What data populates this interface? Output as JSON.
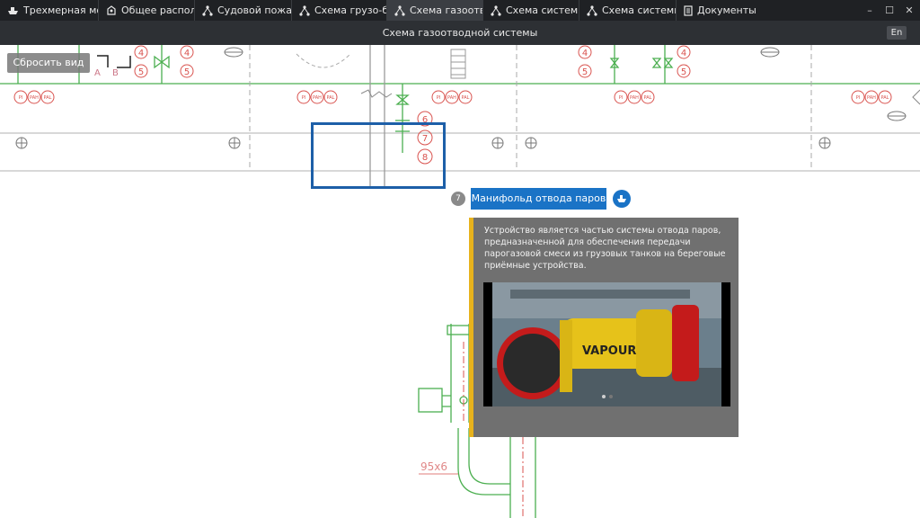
{
  "tabs": [
    {
      "label": "Трехмерная модель",
      "icon": "ship-icon",
      "active": false
    },
    {
      "label": "Общее расположение",
      "icon": "layout-icon",
      "active": false
    },
    {
      "label": "Судовой пожарный",
      "icon": "network-icon",
      "active": false
    },
    {
      "label": "Схема грузо-балластной",
      "icon": "network-icon",
      "active": false
    },
    {
      "label": "Схема газоотводной",
      "icon": "network-icon",
      "active": true
    },
    {
      "label": "Схема системы п",
      "icon": "network-icon",
      "active": false
    },
    {
      "label": "Схема системы к",
      "icon": "network-icon",
      "active": false
    },
    {
      "label": "Документы",
      "icon": "document-icon",
      "active": false
    }
  ],
  "window_controls": {
    "minimize": "–",
    "maximize": "☐",
    "close": "✕"
  },
  "header": {
    "title": "Схема газоотводной системы",
    "language": "En"
  },
  "toolbar": {
    "reset_view": "Сбросить вид"
  },
  "drawing": {
    "tags_top": [
      "4",
      "5",
      "4",
      "5",
      "4",
      "5",
      "A",
      "B",
      "4",
      "5",
      "4",
      "5",
      "4",
      "5"
    ],
    "tags_mid": [
      "6",
      "7",
      "8"
    ],
    "instrument_labels": [
      "PI",
      "PAH",
      "PAL"
    ],
    "dimension_label": "95x6"
  },
  "callout": {
    "number": "7",
    "label": "Манифольд отвода паров",
    "description": "Устройство является частью системы отвода паров, предназначенной для обеспечения передачи парогазовой смеси из грузовых танков на береговые приёмные устройства.",
    "photo_text": "VAPOUR",
    "photo_pages": 2
  },
  "colors": {
    "accent": "#1a73c6",
    "selection": "#1d5fa8",
    "panel": "#707070",
    "panel_accent": "#e7b21c",
    "pipe_green": "#4caf50",
    "tag_red": "#d9534f"
  }
}
